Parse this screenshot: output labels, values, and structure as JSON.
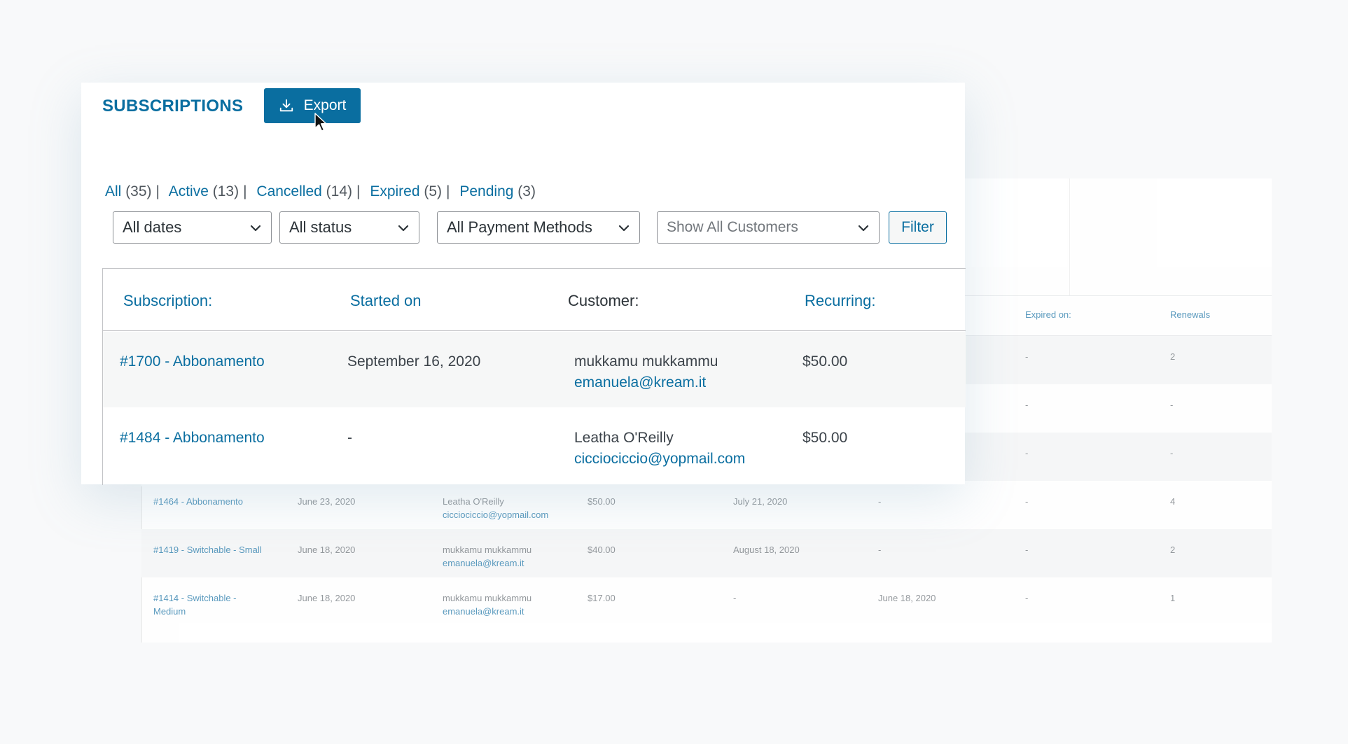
{
  "header": {
    "title": "SUBSCRIPTIONS",
    "export_label": "Export"
  },
  "status_filters": [
    {
      "label": "All",
      "count": "(35)"
    },
    {
      "label": "Active",
      "count": "(13)"
    },
    {
      "label": "Cancelled",
      "count": "(14)"
    },
    {
      "label": "Expired",
      "count": "(5)"
    },
    {
      "label": "Pending",
      "count": "(3)"
    }
  ],
  "filters": {
    "dates": "All dates",
    "status": "All status",
    "payment_methods": "All Payment Methods",
    "customers_placeholder": "Show All Customers",
    "filter_label": "Filter"
  },
  "table": {
    "columns": [
      "Subscription:",
      "Started on",
      "Customer:",
      "Recurring:"
    ],
    "rows": [
      {
        "subscription": "#1700 - Abbonamento",
        "started": "September 16, 2020",
        "customer_name": "mukkamu mukkammu",
        "customer_email": "emanuela@kream.it",
        "recurring": "$50.00"
      },
      {
        "subscription": "#1484 - Abbonamento",
        "started": "-",
        "customer_name": "Leatha O'Reilly",
        "customer_email": "cicciociccio@yopmail.com",
        "recurring": "$50.00"
      }
    ]
  },
  "background_table": {
    "columns": {
      "expired_on": "Expired on:",
      "renewals": "Renewals"
    },
    "top_rows": [
      {
        "expired": "-",
        "renewals": "2"
      },
      {
        "expired": "-",
        "renewals": "-"
      },
      {
        "expired": "-",
        "renewals": "-"
      }
    ],
    "rows": [
      {
        "subscription": "#1464 - Abbonamento",
        "subscription_2": "",
        "started": "June 23, 2020",
        "customer_name": "Leatha O'Reilly",
        "customer_email": "cicciociccio@yopmail.com",
        "recurring": "$50.00",
        "next": "July 21, 2020",
        "ended": "-",
        "expired": "-",
        "renewals": "4"
      },
      {
        "subscription": "#1419 - Switchable - Small",
        "subscription_2": "",
        "started": "June 18, 2020",
        "customer_name": "mukkamu mukkammu",
        "customer_email": "emanuela@kream.it",
        "recurring": "$40.00",
        "next": "August 18, 2020",
        "ended": "-",
        "expired": "-",
        "renewals": "2"
      },
      {
        "subscription": "#1414 - Switchable -",
        "subscription_2": "Medium",
        "started": "June 18, 2020",
        "customer_name": "mukkamu mukkammu",
        "customer_email": "emanuela@kream.it",
        "recurring": "$17.00",
        "next": "-",
        "ended": "June 18, 2020",
        "expired": "-",
        "renewals": "1"
      }
    ]
  },
  "icons": {
    "export": "download-icon",
    "dropdown": "chevron-down-icon",
    "cursor": "mouse-pointer-icon"
  },
  "colors": {
    "accent": "#0a6ea0",
    "text": "#3c434a",
    "border": "#8c8f94",
    "row_alt": "#f6f7f7"
  }
}
